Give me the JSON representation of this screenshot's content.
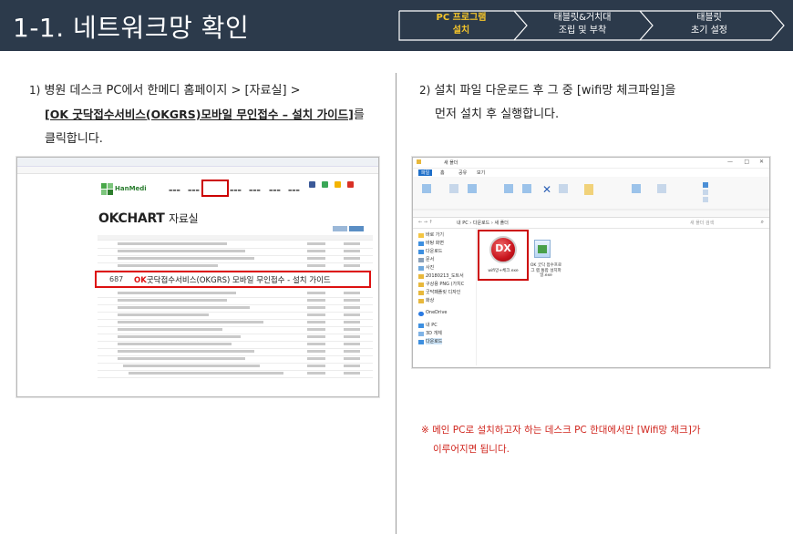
{
  "header": {
    "title": "1-1. 네트워크망 확인",
    "steps": [
      {
        "line1": "PC 프로그램",
        "line2": "설치",
        "active": true
      },
      {
        "line1": "태블릿&거치대",
        "line2": "조립 및 부착",
        "active": false
      },
      {
        "line1": "태블릿",
        "line2": "초기 설정",
        "active": false
      }
    ]
  },
  "left": {
    "step_number": "1)",
    "line1": "병원 데스크 PC에서 한메디 홈페이지 > [자료실] >",
    "link_text": "[OK 굿닥접수서비스(OKGRS)모바일 무인접수 – 설치 가이드]",
    "link_suffix": "를",
    "line3": "클릭합니다.",
    "screenshot": {
      "brand": "HanMedi",
      "page_title_bold": "OKCHART",
      "page_title_rest": "자료실",
      "highlight_number": "687",
      "highlight_prefix": "OK",
      "highlight_text": "굿닥접수서비스(OKGRS) 모바일 무인접수 - 설치 가이드"
    }
  },
  "right": {
    "step_number": "2)",
    "line1": "설치 파일 다운로드 후 그 중 [wifi망 체크파일]을",
    "line2": "먼저 설치 후 실행합니다.",
    "screenshot": {
      "window_title": "새 폴더",
      "tabs": [
        "파일",
        "홈",
        "공유",
        "보기"
      ],
      "address": "내 PC › 다운로드 › 새 폴더",
      "search_placeholder": "새 폴더 검색",
      "sidebar": [
        "바로 가기",
        "바탕 화면",
        "다운로드",
        "문서",
        "사진",
        "20180213_도트서",
        "구상용 PNG (가치C",
        "굿닥패플릿 디자인",
        "화상",
        "OneDrive",
        "내 PC",
        "3D 개체",
        "다운로드"
      ],
      "file1_icon": "DX",
      "file1_label": "wifi망+체크.exe",
      "file2_label": "OK 굿닥 접수프로그 램 통합 설치파 일.exe"
    }
  },
  "note": {
    "line1": "※ 메인 PC로 설치하고자 하는 데스크 PC 한대에서만 [Wifi망 체크]가",
    "line2": "이루어지면 됩니다."
  },
  "colors": {
    "header_bg": "#2c3a4b",
    "active_step": "#f5c52a",
    "highlight_red": "#d11111",
    "note_red": "#d0251d"
  }
}
